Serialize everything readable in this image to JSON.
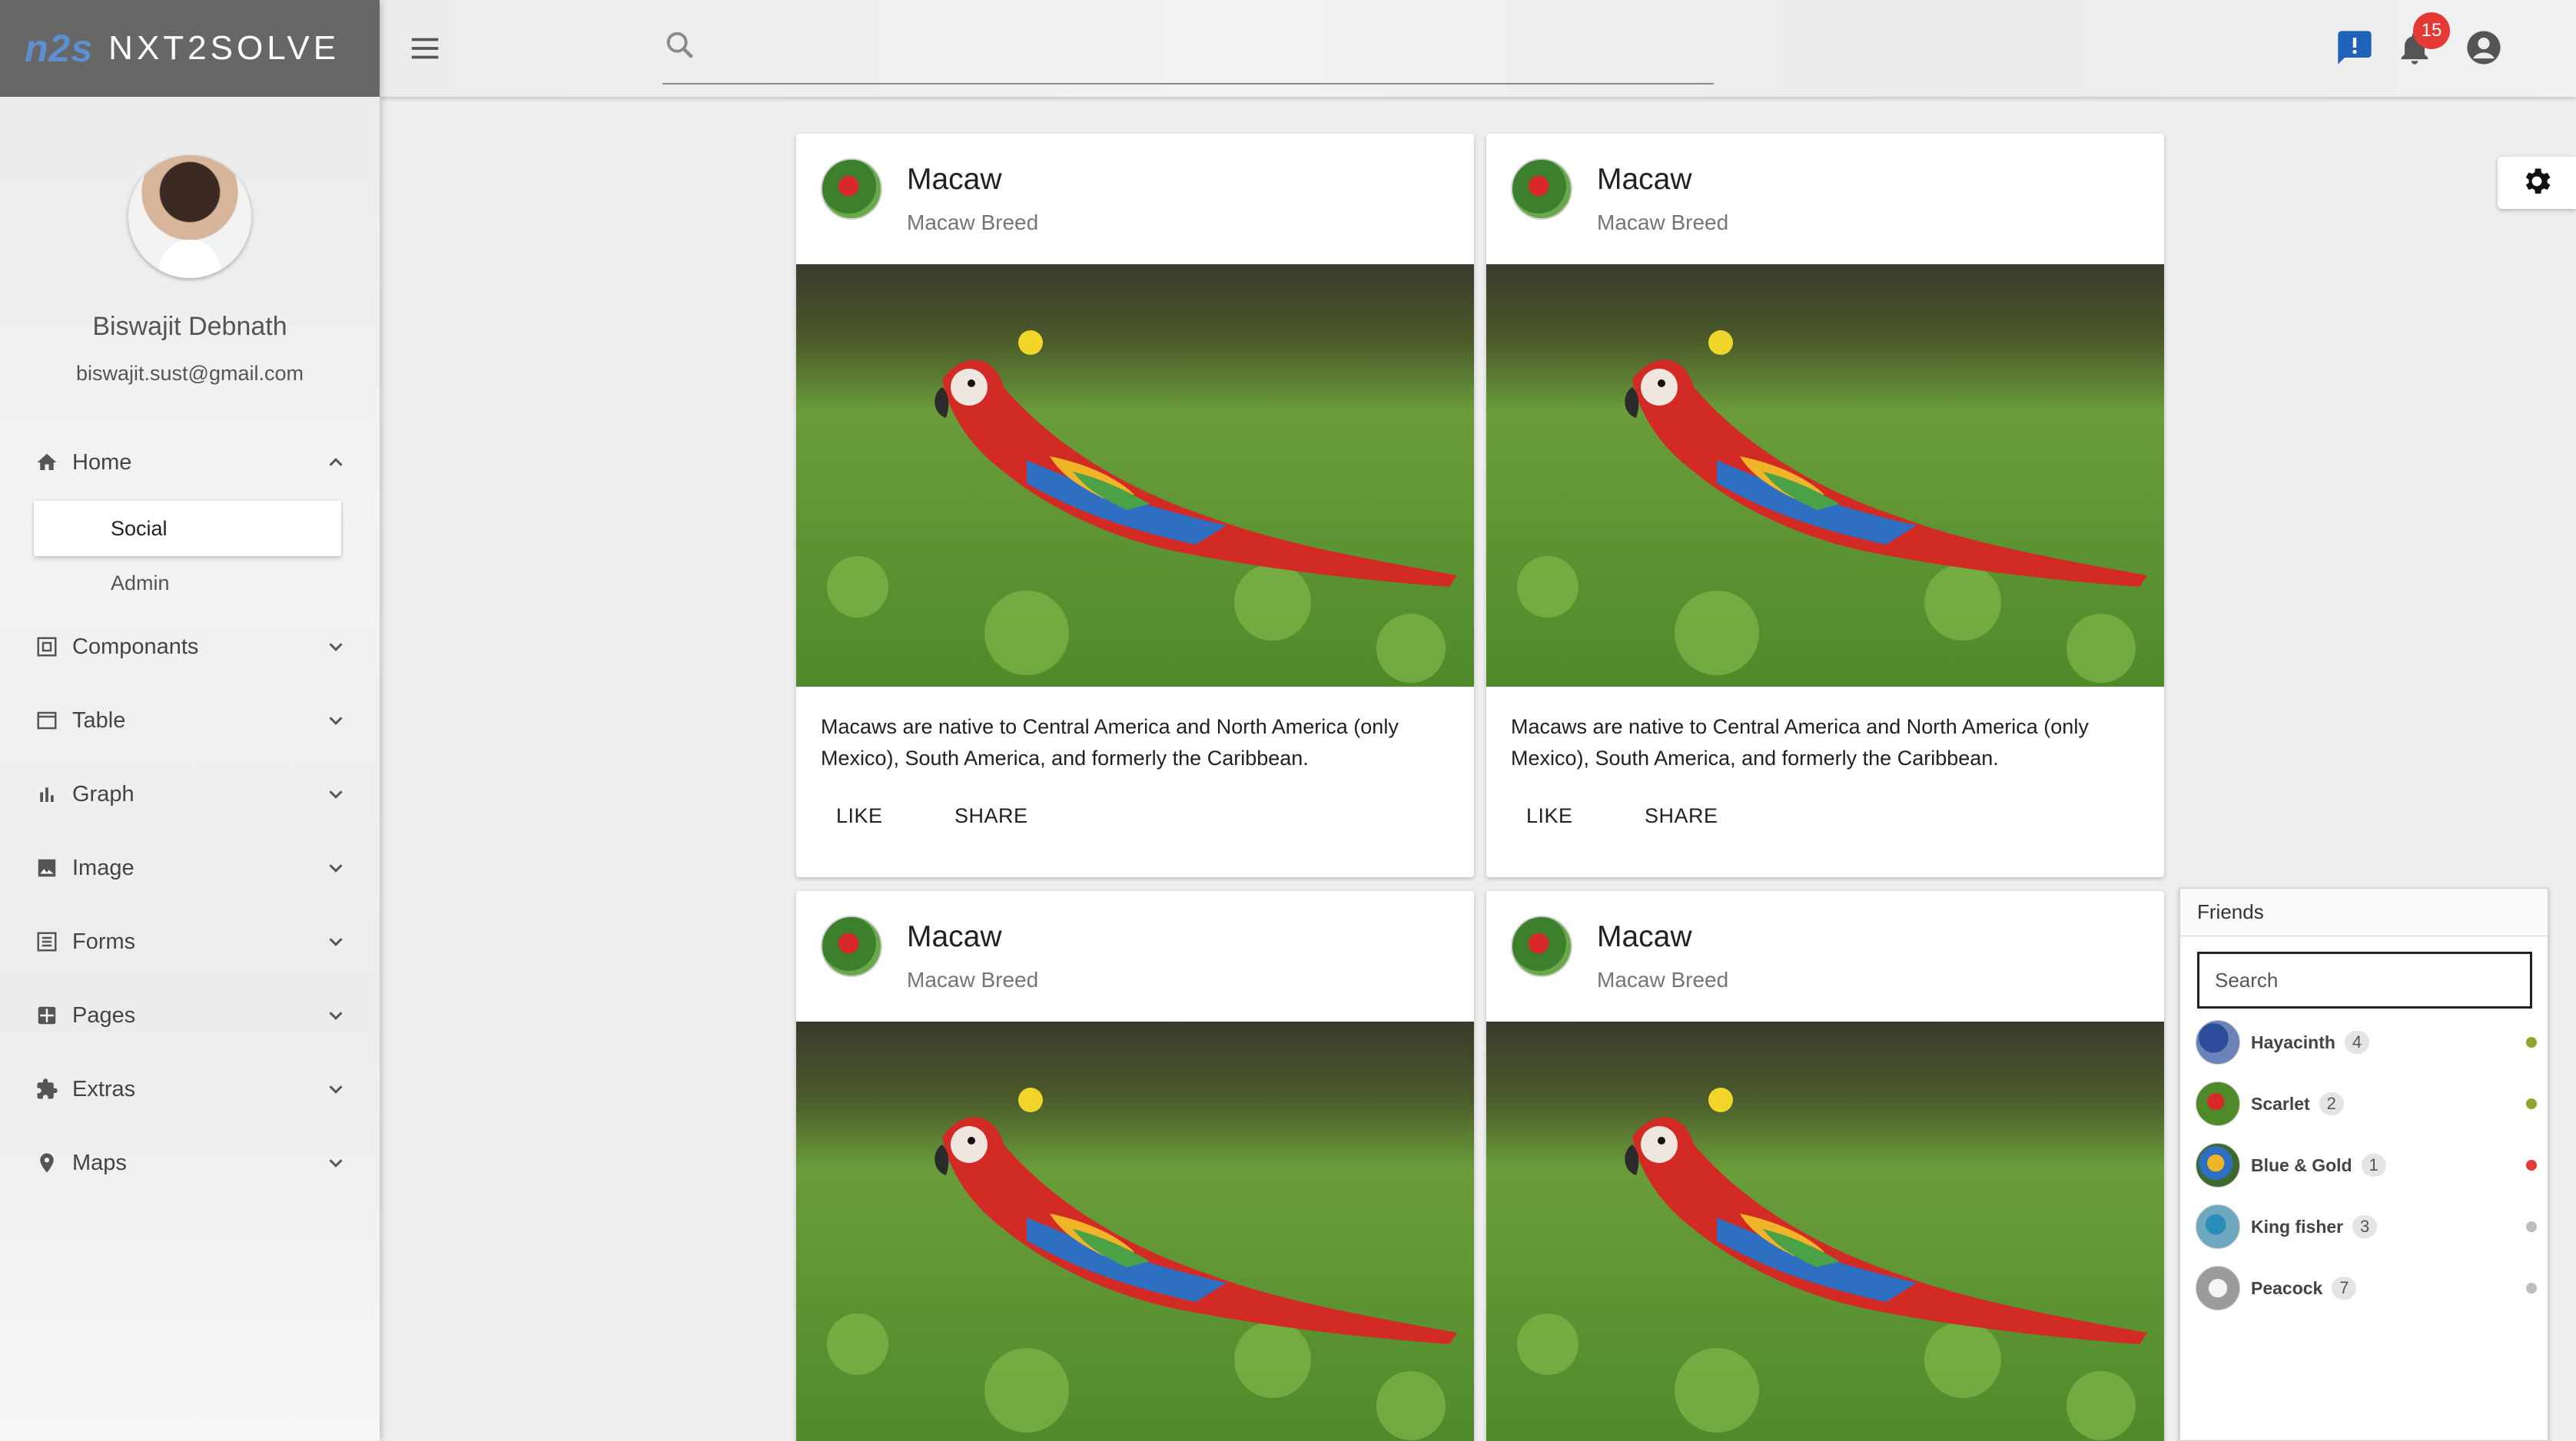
{
  "brand": {
    "logo": "n2s",
    "name": "NXT2SOLVE"
  },
  "user": {
    "name": "Biswajit Debnath",
    "email": "biswajit.sust@gmail.com"
  },
  "sidebar": {
    "items": [
      {
        "label": "Home",
        "icon": "home-icon",
        "expanded": true
      },
      {
        "label": "Componants",
        "icon": "components-icon",
        "expanded": false
      },
      {
        "label": "Table",
        "icon": "table-icon",
        "expanded": false
      },
      {
        "label": "Graph",
        "icon": "graph-icon",
        "expanded": false
      },
      {
        "label": "Image",
        "icon": "image-icon",
        "expanded": false
      },
      {
        "label": "Forms",
        "icon": "forms-icon",
        "expanded": false
      },
      {
        "label": "Pages",
        "icon": "pages-icon",
        "expanded": false
      },
      {
        "label": "Extras",
        "icon": "extras-icon",
        "expanded": false
      },
      {
        "label": "Maps",
        "icon": "maps-icon",
        "expanded": false
      }
    ],
    "home_sub": [
      {
        "label": "Social",
        "active": true
      },
      {
        "label": "Admin",
        "active": false
      }
    ]
  },
  "topbar": {
    "search_placeholder": "",
    "notification_count": "15",
    "icons": [
      "menu-icon",
      "search-icon",
      "feedback-icon",
      "bell-icon",
      "account-icon"
    ]
  },
  "cards": [
    {
      "title": "Macaw",
      "subtitle": "Macaw Breed",
      "text": "Macaws are native to Central America and North America (only Mexico), South America, and formerly the Caribbean.",
      "like": "LIKE",
      "share": "SHARE"
    },
    {
      "title": "Macaw",
      "subtitle": "Macaw Breed",
      "text": "Macaws are native to Central America and North America (only Mexico), South America, and formerly the Caribbean.",
      "like": "LIKE",
      "share": "SHARE"
    },
    {
      "title": "Macaw",
      "subtitle": "Macaw Breed"
    },
    {
      "title": "Macaw",
      "subtitle": "Macaw Breed"
    }
  ],
  "friends": {
    "title": "Friends",
    "search_placeholder": "Search",
    "list": [
      {
        "name": "Hayacinth",
        "count": "4",
        "status_color": "#8aa82b"
      },
      {
        "name": "Scarlet",
        "count": "2",
        "status_color": "#8aa82b"
      },
      {
        "name": "Blue & Gold",
        "count": "1",
        "status_color": "#e53935"
      },
      {
        "name": "King fisher",
        "count": "3",
        "status_color": "#bdbdbd"
      },
      {
        "name": "Peacock",
        "count": "7",
        "status_color": "#bdbdbd"
      }
    ]
  },
  "colors": {
    "brand_bg": "#676767",
    "logo": "#5d8fd0",
    "badge": "#e53935",
    "feedback": "#1e63b8"
  }
}
